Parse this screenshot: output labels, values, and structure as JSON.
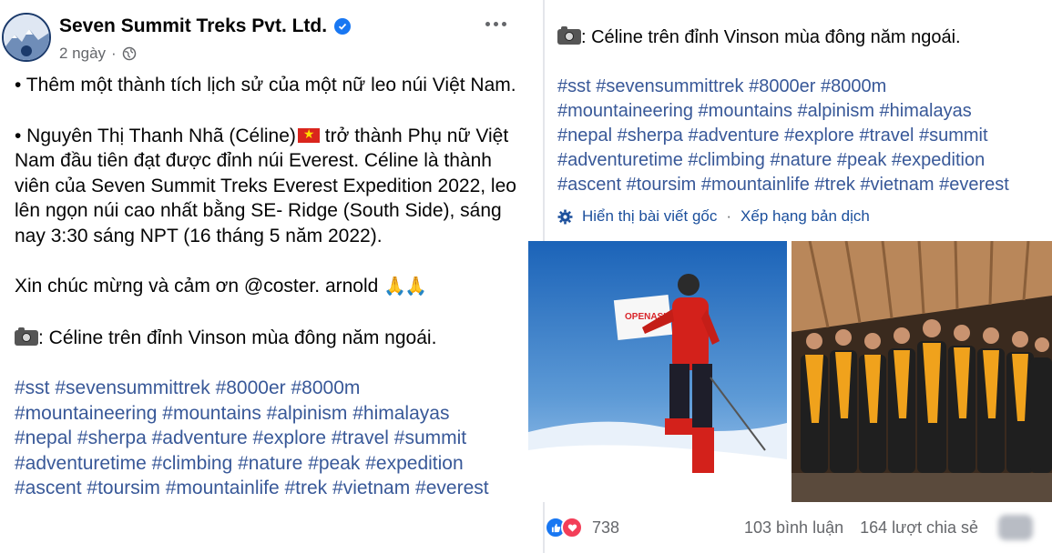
{
  "post": {
    "page_name": "Seven Summit Treks Pvt. Ltd.",
    "time": "2 ngày",
    "paragraph1": "• Thêm một thành tích lịch sử của một nữ leo núi Việt Nam.",
    "paragraph2a": "• Nguyên Thị Thanh Nhã (Céline)",
    "paragraph2b": " trở thành Phụ nữ Việt Nam đầu tiên đạt được đỉnh núi Everest. Céline là thành viên của Seven Summit Treks Everest Expedition 2022, leo lên ngọn núi cao nhất bằng SE- Ridge (South Side), sáng nay 3:30 sáng NPT (16 tháng 5 năm 2022).",
    "paragraph3": "Xin chúc mừng và cảm ơn @coster. arnold ",
    "paragraph4": ": Céline trên đỉnh Vinson mùa đông năm ngoái.",
    "hashtag_lines": [
      "#sst #sevensummittrek #8000er #8000m",
      "#mountaineering #mountains #alpinism #himalayas",
      "#nepal #sherpa #adventure  #explore #travel #summit",
      "#adventuretime #climbing #nature #peak #expedition",
      "#ascent #toursim #mountainlife #trek #vietnam #everest"
    ]
  },
  "right": {
    "caption": ": Céline trên đỉnh Vinson mùa đông năm ngoái.",
    "hashtag_lines": [
      "#sst #sevensummittrek #8000er #8000m",
      "#mountaineering #mountains #alpinism #himalayas",
      "#nepal #sherpa #adventure  #explore #travel #summit",
      "#adventuretime #climbing #nature #peak #expedition",
      "#ascent #toursim #mountainlife #trek #vietnam #everest"
    ],
    "show_original": "Hiển thị bài viết gốc",
    "separator": "·",
    "rate_translation": "Xếp hạng bản dịch",
    "flag_banner_text": "OPENASIA",
    "reaction_count": "738",
    "comments": "103 bình luận",
    "shares": "164 lượt chia sẻ"
  },
  "colors": {
    "link_blue": "#385898",
    "facebook_blue": "#1877f2",
    "muted_gray": "#65676b"
  },
  "icons": [
    "verified-badge-icon",
    "globe-icon",
    "more-options-icon",
    "camera-emoji-icon",
    "vietnam-flag-icon",
    "pray-hands-icon",
    "gear-icon",
    "like-reaction-icon",
    "love-reaction-icon"
  ]
}
